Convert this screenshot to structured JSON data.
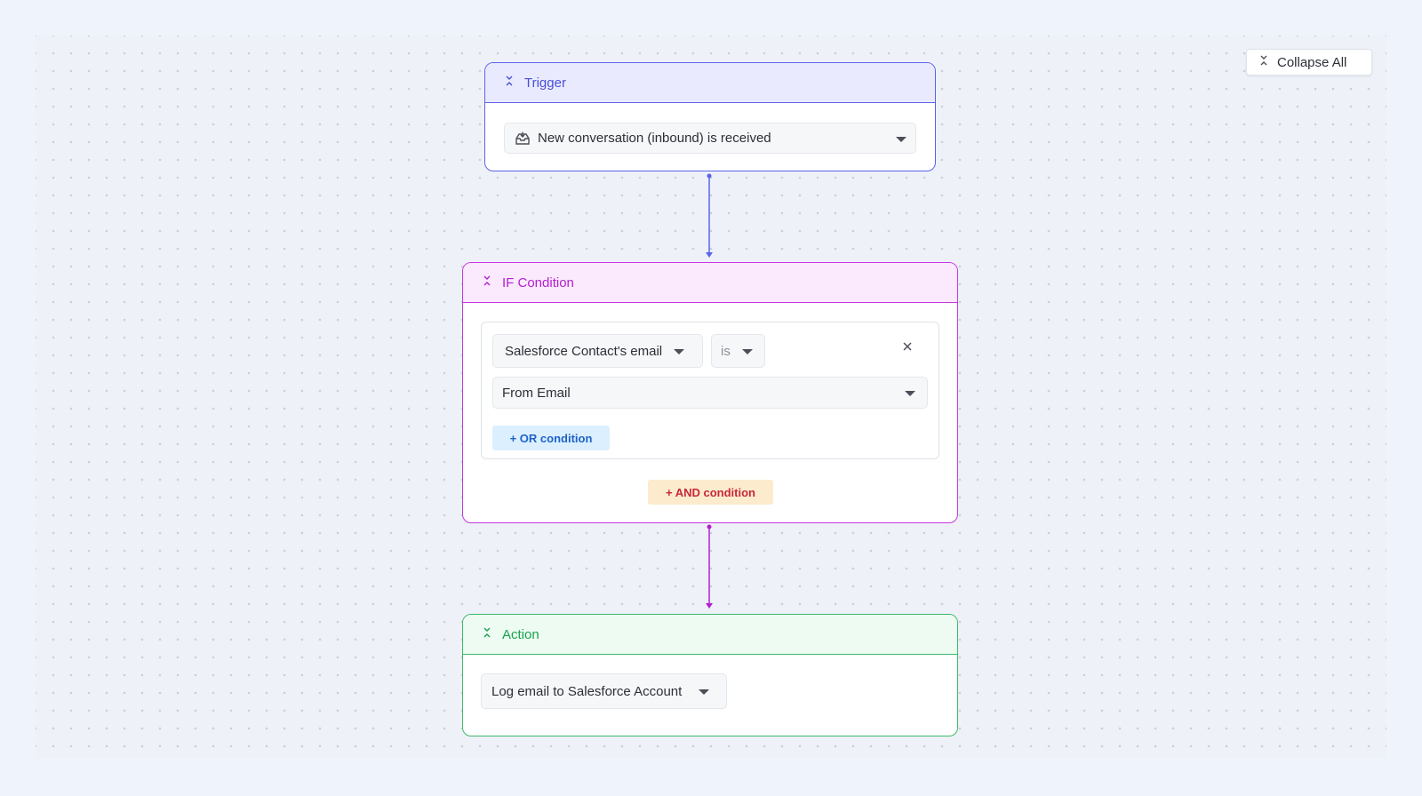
{
  "toolbar": {
    "collapse_all_label": "Collapse All"
  },
  "trigger": {
    "title": "Trigger",
    "event_value": "New conversation (inbound) is received"
  },
  "condition": {
    "title": "IF Condition",
    "field_value": "Salesforce Contact's email",
    "operator_value": "is",
    "compare_value": "From Email",
    "or_label": "+ OR condition",
    "and_label": "+ AND condition"
  },
  "action": {
    "title": "Action",
    "action_value": "Log email to Salesforce Account"
  },
  "colors": {
    "trigger": "#5b63ea",
    "condition": "#c436e0",
    "action": "#3cb96a"
  }
}
